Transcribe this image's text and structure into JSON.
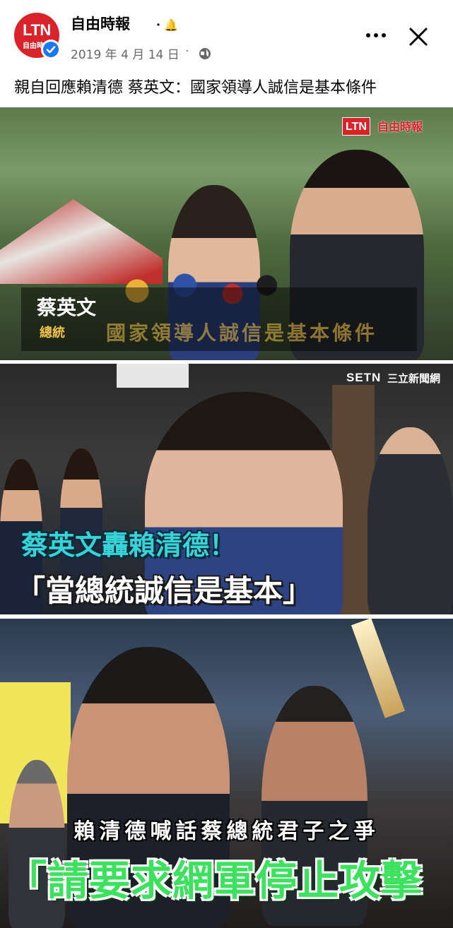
{
  "post": {
    "page_name": "自由時報",
    "bell_symbol": "・🔔",
    "date": "2019 年 4 月 14 日",
    "meta_separator": "·",
    "caption": "親自回應賴清德 蔡英文：國家領導人誠信是基本條件",
    "avatar": {
      "line1": "LTN",
      "line2": "自由時報"
    },
    "icons": {
      "verified": "verified-badge-icon",
      "audience": "globe-icon",
      "more": "more-options-icon",
      "close": "close-icon",
      "notifications": "bell-icon"
    }
  },
  "images": [
    {
      "watermark": "LTN",
      "watermark_sub": "自由時報",
      "name_tag": "蔡英文",
      "title_tag": "總統",
      "ghost_caption": "國家領導人誠信是基本條件",
      "mute_icon": "muted-speaker-icon"
    },
    {
      "watermark": "SETN",
      "watermark_sub": "三立新聞網",
      "headline_top": "蔡英文轟賴清德！",
      "headline_bottom": "「當總統誠信是基本」"
    },
    {
      "subtitle": "賴清德喊話蔡總統君子之爭",
      "headline": "「請要求網軍停止攻擊"
    }
  ],
  "colors": {
    "ltn_red": "#d8232a",
    "verified_blue": "#1877f2",
    "text_primary": "#050505",
    "text_secondary": "#65676b",
    "cyan_headline": "#37d3d6",
    "green_headline": "#3ee05f"
  }
}
